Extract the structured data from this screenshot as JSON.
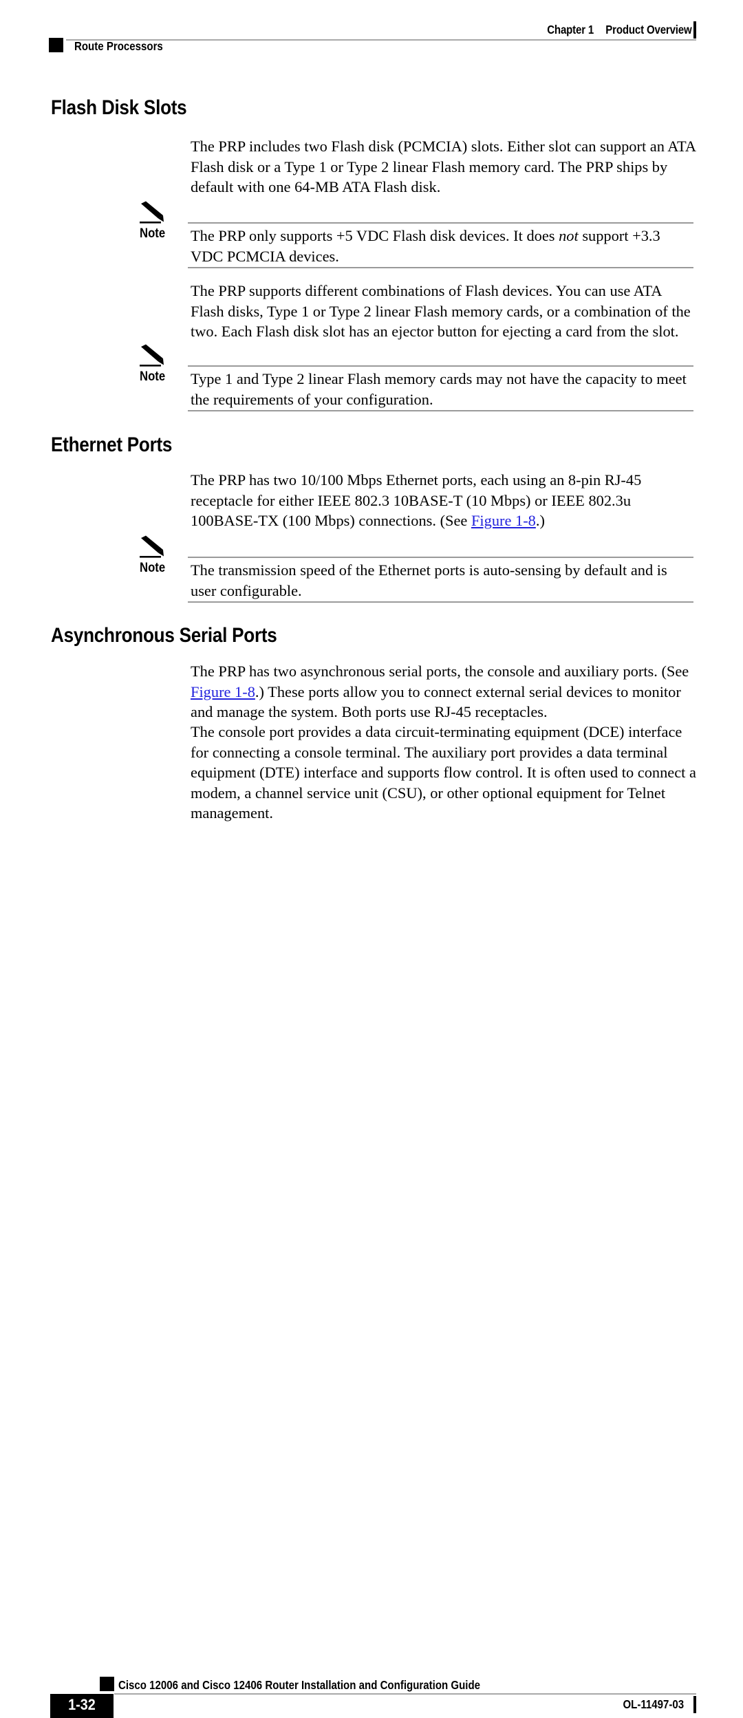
{
  "header": {
    "chapter_label": "Chapter 1",
    "chapter_title": "Product Overview",
    "section_name": "Route Processors"
  },
  "footer": {
    "page_number": "1-32",
    "book_title": "Cisco 12006 and Cisco 12406 Router Installation and Configuration Guide",
    "doc_id": "OL-11497-03"
  },
  "colors": {
    "link": "#2222dd",
    "rule": "#a8a8a8",
    "text": "#000000",
    "page_box": "#000000"
  },
  "sections": [
    {
      "heading": "Flash Disk Slots",
      "paragraph_1": "The PRP includes two Flash disk (PCMCIA) slots. Either slot can support an ATA Flash disk or a Type 1 or Type 2 linear Flash memory card. The PRP ships by default with one 64-MB ATA Flash disk.",
      "note_1": {
        "label": "Note",
        "text_a": "The PRP only supports +5 VDC Flash disk devices. It does ",
        "text_italic": "not",
        "text_b": " support +3.3 VDC PCMCIA devices."
      },
      "paragraph_2": "The PRP supports different combinations of Flash devices. You can use ATA Flash disks, Type 1 or Type 2 linear Flash memory cards, or a combination of the two. Each Flash disk slot has an ejector button for ejecting a card from the slot.",
      "note_2": {
        "label": "Note",
        "text": "Type 1 and Type 2 linear Flash memory cards may not have the capacity to meet the requirements of your configuration."
      }
    },
    {
      "heading": "Ethernet Ports",
      "paragraph_1_a": "The PRP has two 10/100 Mbps Ethernet ports, each using an 8-pin RJ-45 receptacle for either IEEE 802.3 10BASE-T (10 Mbps) or IEEE 802.3u 100BASE-TX (100 Mbps) connections. (See ",
      "paragraph_1_link": "Figure 1-8",
      "paragraph_1_b": ".)",
      "note_1": {
        "label": "Note",
        "text": "The transmission speed of the Ethernet ports is auto-sensing by default and is user configurable."
      }
    },
    {
      "heading": "Asynchronous Serial Ports",
      "paragraph_1_a": "The PRP has two asynchronous serial ports, the console and auxiliary ports. (See ",
      "paragraph_1_link": "Figure 1-8",
      "paragraph_1_b": ".) These ports allow you to connect external serial devices to monitor and manage the system. Both ports use RJ-45 receptacles.",
      "paragraph_2": "The console port provides a data circuit-terminating equipment (DCE) interface for connecting a console terminal. The auxiliary port provides a data terminal equipment (DTE) interface and supports flow control. It is often used to connect a modem, a channel service unit (CSU), or other optional equipment for Telnet management."
    }
  ],
  "icons": {
    "note": "pencil-icon"
  }
}
